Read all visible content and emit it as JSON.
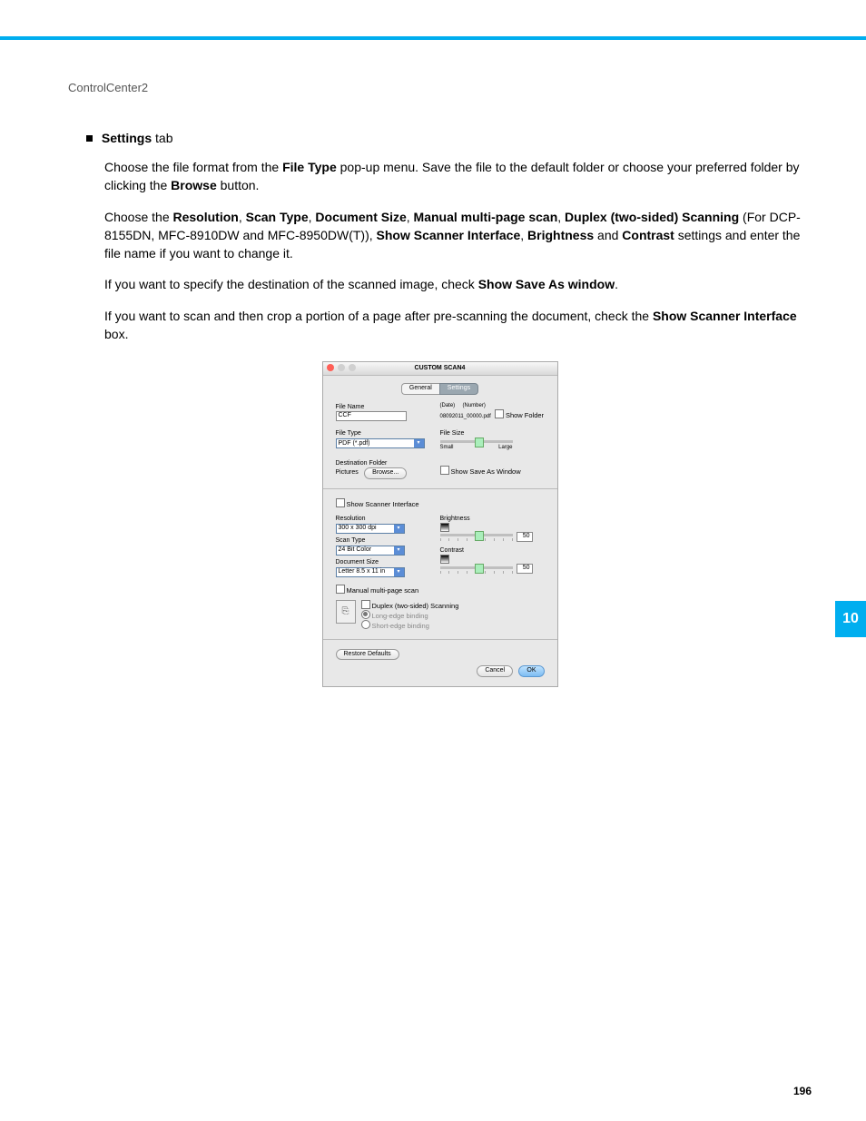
{
  "header": {
    "breadcrumb": "ControlCenter2"
  },
  "section": {
    "bullet_head_bold": "Settings",
    "bullet_head_rest": " tab",
    "p1_a": "Choose the file format from the ",
    "p1_b": "File Type",
    "p1_c": " pop-up menu. Save the file to the default folder or choose your preferred folder by clicking the ",
    "p1_d": "Browse",
    "p1_e": " button.",
    "p2_a": "Choose the ",
    "p2_b": "Resolution",
    "p2_c": ", ",
    "p2_d": "Scan Type",
    "p2_e": ", ",
    "p2_f": "Document Size",
    "p2_g": ", ",
    "p2_h": "Manual multi-page scan",
    "p2_i": ", ",
    "p2_j": "Duplex (two-sided) Scanning",
    "p2_k": " (For DCP-8155DN, MFC-8910DW and MFC-8950DW(T)), ",
    "p2_l": "Show Scanner Interface",
    "p2_m": ", ",
    "p2_n": "Brightness",
    "p2_o": " and ",
    "p2_p": "Contrast",
    "p2_q": " settings and enter the file name if you want to change it.",
    "p3_a": "If you want to specify the destination of the scanned image, check ",
    "p3_b": "Show Save As window",
    "p3_c": ".",
    "p4_a": "If you want to scan and then crop a portion of a page after pre-scanning the document, check the ",
    "p4_b": "Show Scanner Interface",
    "p4_c": " box."
  },
  "dialog": {
    "title": "CUSTOM SCAN4",
    "tabs": {
      "general": "General",
      "settings": "Settings"
    },
    "filename_label": "File Name",
    "filename_value": "CCF",
    "date_label": "(Date)",
    "number_label": "(Number)",
    "filename_preview": "08092011_00000.pdf",
    "show_folder": "Show Folder",
    "filetype_label": "File Type",
    "filetype_value": "PDF (*.pdf)",
    "destfolder_label": "Destination Folder",
    "destfolder_value": "Pictures",
    "browse": "Browse...",
    "filesize_label": "File Size",
    "filesize_small": "Small",
    "filesize_large": "Large",
    "show_save_as": "Show Save As Window",
    "show_scanner_if": "Show Scanner Interface",
    "resolution_label": "Resolution",
    "resolution_value": "300 x 300 dpi",
    "scantype_label": "Scan Type",
    "scantype_value": "24 Bit Color",
    "docsize_label": "Document Size",
    "docsize_value": "Letter  8.5 x 11 in",
    "brightness_label": "Brightness",
    "brightness_value": "50",
    "contrast_label": "Contrast",
    "contrast_value": "50",
    "manual_multipage": "Manual multi-page scan",
    "duplex_label": "Duplex (two-sided) Scanning",
    "long_edge": "Long-edge binding",
    "short_edge": "Short-edge binding",
    "restore": "Restore Defaults",
    "cancel": "Cancel",
    "ok": "OK"
  },
  "pagenum": "196",
  "chapter_tab": "10"
}
